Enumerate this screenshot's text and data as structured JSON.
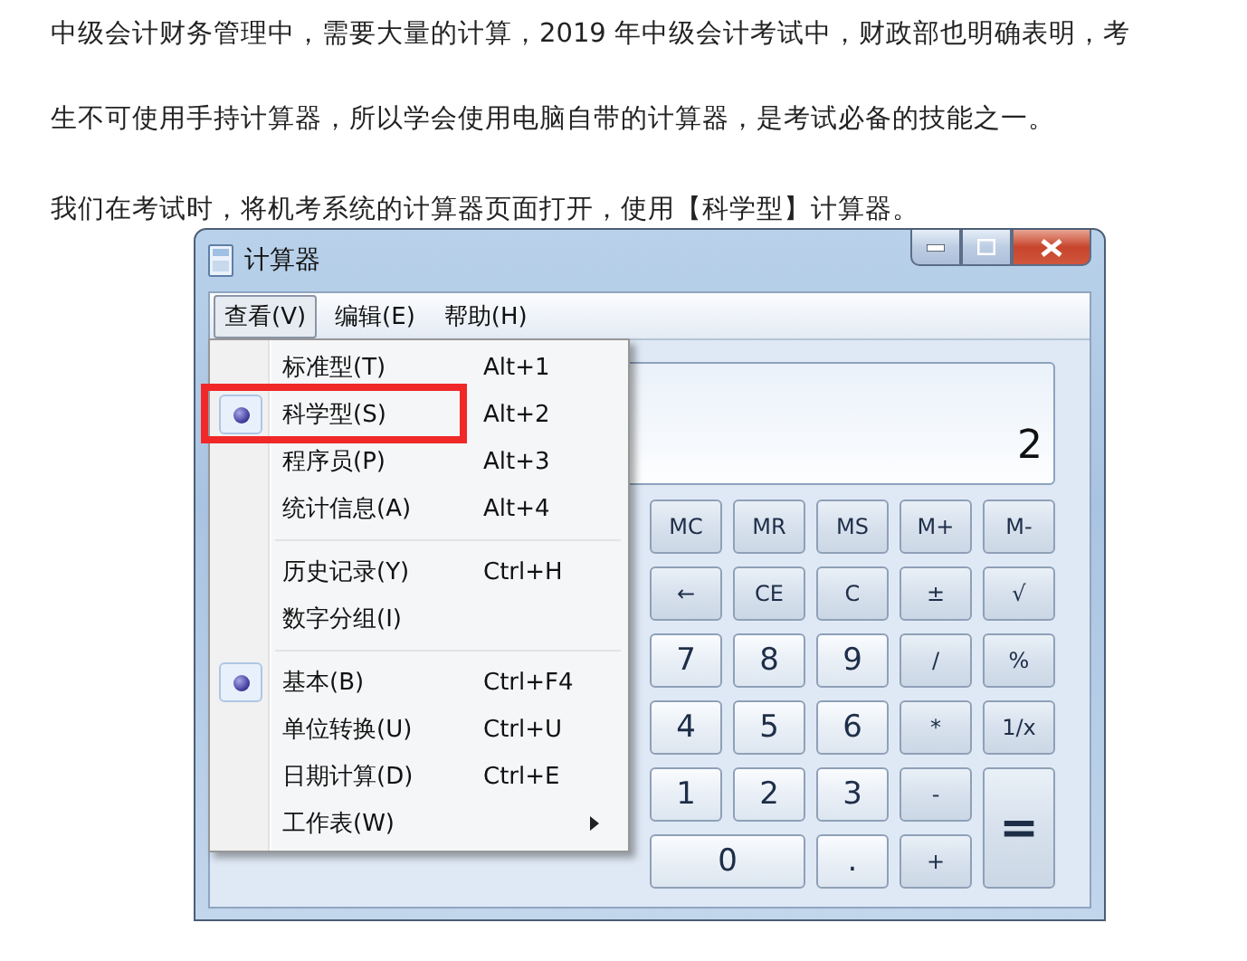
{
  "text_lines": [
    "中级会计财务管理中，需要大量的计算，2019 年中级会计考试中，财政部也明确表明，考",
    "生不可使用手持计算器，所以学会使用电脑自带的计算器，是考试必备的技能之一。",
    "我们在考试时，将机考系统的计算器页面打开，使用【科学型】计算器。"
  ],
  "calculator": {
    "title": "计算器",
    "menu_bar": [
      {
        "label": "查看(V)",
        "selected": true
      },
      {
        "label": "编辑(E)",
        "selected": false
      },
      {
        "label": "帮助(H)",
        "selected": false
      }
    ],
    "dropdown": [
      {
        "kind": "item",
        "label": "标准型(T)",
        "shortcut": "Alt+1",
        "selected": false,
        "highlighted": false
      },
      {
        "kind": "item",
        "label": "科学型(S)",
        "shortcut": "Alt+2",
        "selected": true,
        "highlighted": true
      },
      {
        "kind": "item",
        "label": "程序员(P)",
        "shortcut": "Alt+3",
        "selected": false,
        "highlighted": false
      },
      {
        "kind": "item",
        "label": "统计信息(A)",
        "shortcut": "Alt+4",
        "selected": false,
        "highlighted": false
      },
      {
        "kind": "separator"
      },
      {
        "kind": "item",
        "label": "历史记录(Y)",
        "shortcut": "Ctrl+H",
        "selected": false,
        "highlighted": false
      },
      {
        "kind": "item",
        "label": "数字分组(I)",
        "selected": false,
        "highlighted": false
      },
      {
        "kind": "separator"
      },
      {
        "kind": "item",
        "label": "基本(B)",
        "shortcut": "Ctrl+F4",
        "selected": true,
        "highlighted": false
      },
      {
        "kind": "item",
        "label": "单位转换(U)",
        "shortcut": "Ctrl+U",
        "selected": false,
        "highlighted": false
      },
      {
        "kind": "item",
        "label": "日期计算(D)",
        "shortcut": "Ctrl+E",
        "selected": false,
        "highlighted": false
      },
      {
        "kind": "submenu",
        "label": "工作表(W)",
        "selected": false,
        "highlighted": false
      }
    ],
    "display": "2",
    "keys": [
      {
        "label": "MC"
      },
      {
        "label": "MR"
      },
      {
        "label": "MS"
      },
      {
        "label": "M+"
      },
      {
        "label": "M-"
      },
      {
        "label": "←"
      },
      {
        "label": "CE"
      },
      {
        "label": "C"
      },
      {
        "label": "±"
      },
      {
        "label": "√"
      },
      {
        "label": "7",
        "kind": "digit"
      },
      {
        "label": "8",
        "kind": "digit"
      },
      {
        "label": "9",
        "kind": "digit"
      },
      {
        "label": "/"
      },
      {
        "label": "%"
      },
      {
        "label": "4",
        "kind": "digit"
      },
      {
        "label": "5",
        "kind": "digit"
      },
      {
        "label": "6",
        "kind": "digit"
      },
      {
        "label": "*"
      },
      {
        "label": "1/x"
      },
      {
        "label": "1",
        "kind": "digit"
      },
      {
        "label": "2",
        "kind": "digit"
      },
      {
        "label": "3",
        "kind": "digit"
      },
      {
        "label": "-"
      },
      {
        "label": "=",
        "kind": "tall"
      },
      {
        "label": "0",
        "kind": "wide"
      },
      {
        "label": ".",
        "kind": "digit"
      },
      {
        "label": "+"
      }
    ]
  }
}
